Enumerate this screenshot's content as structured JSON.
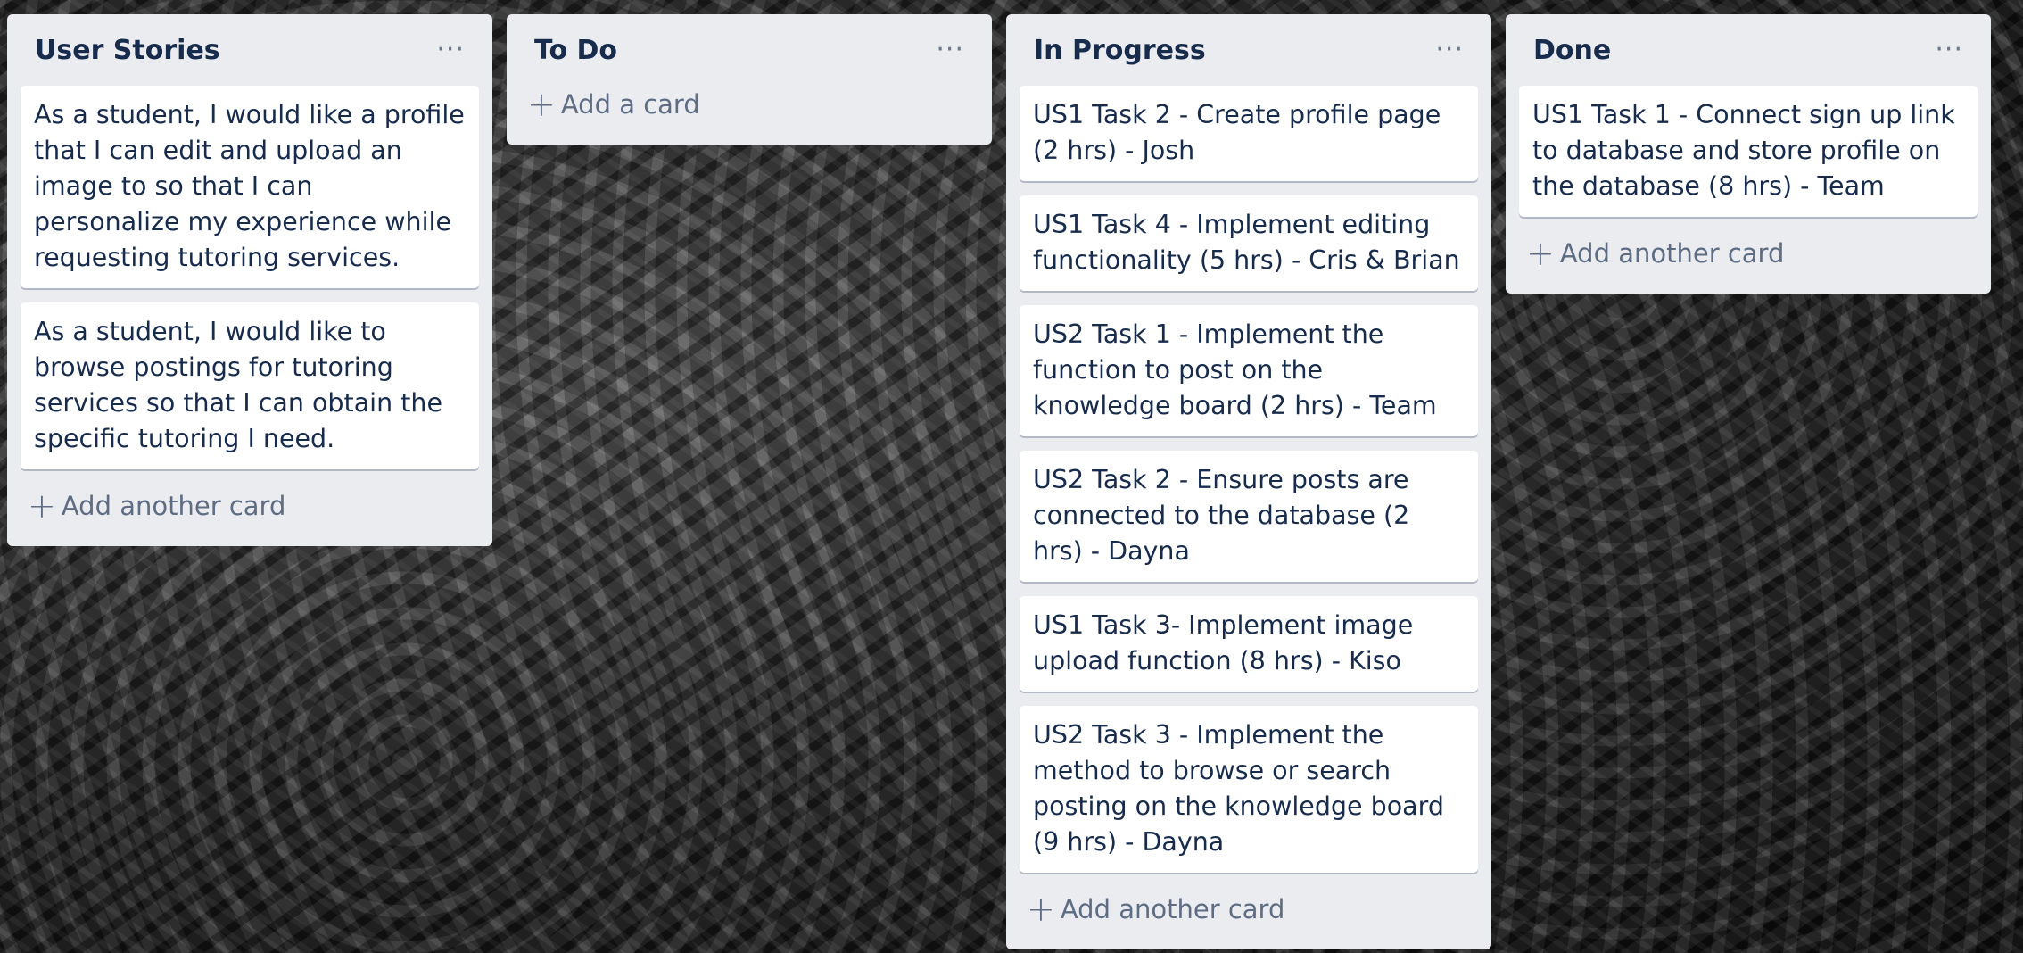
{
  "board": {
    "lists": [
      {
        "title": "User Stories",
        "cards": [
          "As a student, I would like a profile that I can edit and upload an image to so that I can personalize my experience while requesting tutoring services.",
          "As a student, I would like to browse postings for tutoring services so that I can obtain the specific tutoring I need."
        ],
        "add_label": "Add another card"
      },
      {
        "title": "To Do",
        "cards": [],
        "add_label": "Add a card"
      },
      {
        "title": "In Progress",
        "cards": [
          "US1 Task 2 - Create profile page (2 hrs) - Josh",
          "US1 Task 4 - Implement editing functionality (5 hrs) - Cris & Brian",
          "US2 Task 1 - Implement the function to post on the knowledge board (2 hrs) - Team",
          "US2 Task 2 - Ensure posts are connected to the database (2 hrs) - Dayna",
          "US1 Task 3- Implement image upload function (8 hrs) - Kiso",
          "US2 Task 3 - Implement the method to browse or search posting on the knowledge board (9 hrs) - Dayna"
        ],
        "add_label": "Add another card"
      },
      {
        "title": "Done",
        "cards": [
          "US1 Task 1 - Connect sign up link to database and store profile on the database (8 hrs) - Team"
        ],
        "add_label": "Add another card"
      }
    ]
  },
  "icons": {
    "list_menu": "more-horizontal-icon",
    "add": "plus-icon"
  },
  "colors": {
    "list_background": "#ebecf0",
    "card_background": "#ffffff",
    "title_text": "#172b4d",
    "muted_text": "#5e6c84"
  }
}
